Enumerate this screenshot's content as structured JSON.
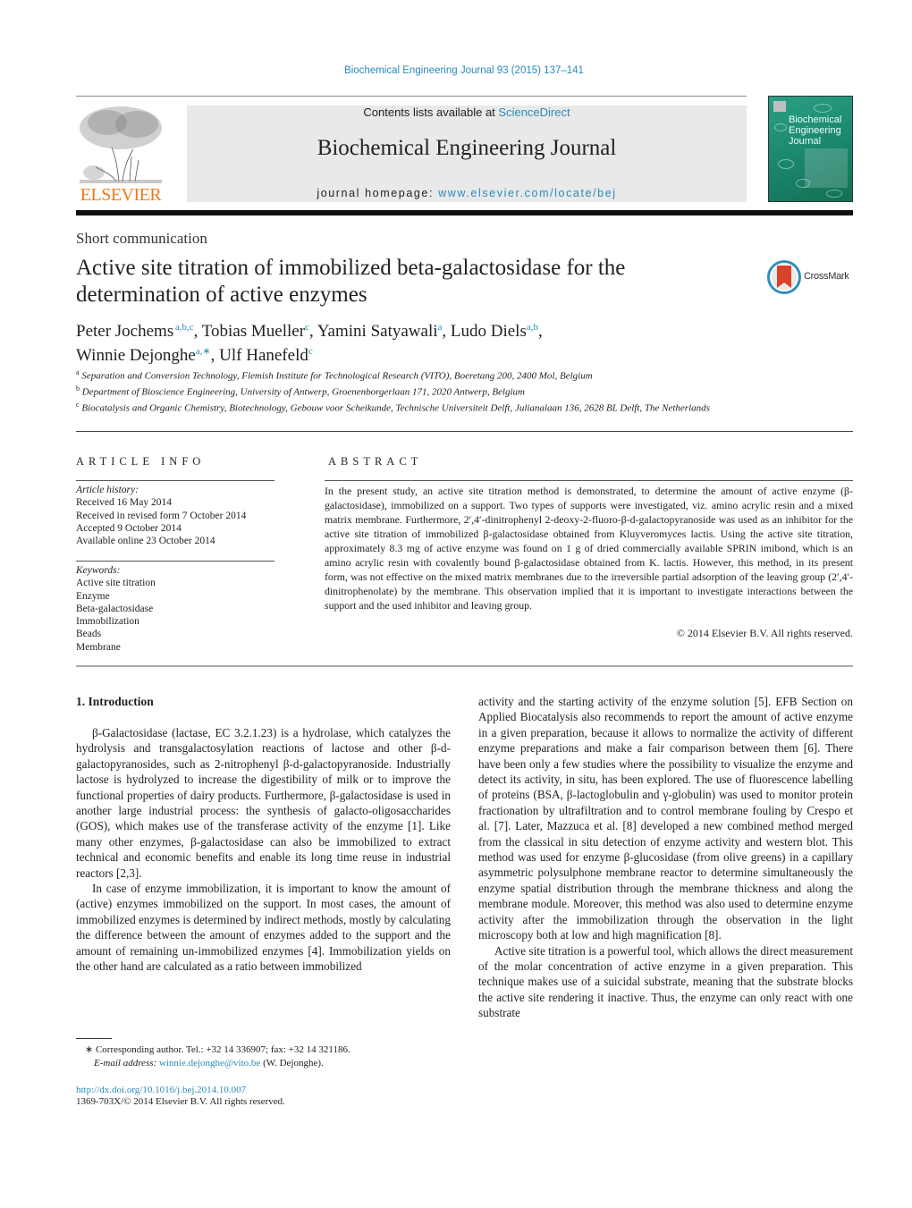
{
  "header": {
    "journal_ref": "Biochemical Engineering Journal 93 (2015) 137–141",
    "contents_prefix": "Contents lists available at ",
    "contents_link": "ScienceDirect",
    "journal_title": "Biochemical Engineering Journal",
    "homepage_prefix": "journal homepage: ",
    "homepage_link": "www.elsevier.com/locate/bej",
    "publisher_logo_text": "ELSEVIER",
    "cover_title_lines": [
      "Biochemical",
      "Engineering",
      "Journal"
    ],
    "crossmark_label": "CrossMark",
    "colors": {
      "link": "#2a8bb8",
      "elsevier_orange": "#f07a1a",
      "cover_green": "#1d8a70",
      "crossmark_red": "#d9412b"
    }
  },
  "article": {
    "type": "Short communication",
    "title": "Active site titration of immobilized beta-galactosidase for the determination of active enzymes",
    "authors": [
      {
        "name": "Peter Jochems",
        "affil": "a,b,c",
        "sep": ", "
      },
      {
        "name": "Tobias Mueller",
        "affil": "c",
        "sep": ", "
      },
      {
        "name": "Yamini Satyawali",
        "affil": "a",
        "sep": ", "
      },
      {
        "name": "Ludo Diels",
        "affil": "a,b",
        "sep": ", "
      },
      {
        "name": "Winnie Dejonghe",
        "affil": "a,∗",
        "sep": ", "
      },
      {
        "name": "Ulf Hanefeld",
        "affil": "c",
        "sep": ""
      }
    ],
    "affiliations": [
      {
        "key": "a",
        "text": "Separation and Conversion Technology, Flemish Institute for Technological Research (VITO), Boeretang 200, 2400 Mol, Belgium"
      },
      {
        "key": "b",
        "text": "Department of Bioscience Engineering, University of Antwerp, Groenenborgerlaan 171, 2020 Antwerp, Belgium"
      },
      {
        "key": "c",
        "text": "Biocatalysis and Organic Chemistry, Biotechnology, Gebouw voor Scheikunde, Technische Universiteit Delft, Julianalaan 136, 2628 BL Delft, The Netherlands"
      }
    ]
  },
  "article_info": {
    "label": "ARTICLE INFO",
    "history_head": "Article history:",
    "history": [
      "Received 16 May 2014",
      "Received in revised form 7 October 2014",
      "Accepted 9 October 2014",
      "Available online 23 October 2014"
    ],
    "keywords_head": "Keywords:",
    "keywords": [
      "Active site titration",
      "Enzyme",
      "Beta-galactosidase",
      "Immobilization",
      "Beads",
      "Membrane"
    ]
  },
  "abstract": {
    "label": "ABSTRACT",
    "text": "In the present study, an active site titration method is demonstrated, to determine the amount of active enzyme (β-galactosidase), immobilized on a support. Two types of supports were investigated, viz. amino acrylic resin and a mixed matrix membrane. Furthermore, 2′,4′-dinitrophenyl 2-deoxy-2-fluoro-β-d-galactopyranoside was used as an inhibitor for the active site titration of immobilized β-galactosidase obtained from Kluyveromyces lactis. Using the active site titration, approximately 8.3 mg of active enzyme was found on 1 g of dried commercially available SPRIN imibond, which is an amino acrylic resin with covalently bound β-galactosidase obtained from K. lactis. However, this method, in its present form, was not effective on the mixed matrix membranes due to the irreversible partial adsorption of the leaving group (2′,4′-dinitrophenolate) by the membrane. This observation implied that it is important to investigate interactions between the support and the used inhibitor and leaving group.",
    "copyright": "© 2014 Elsevier B.V. All rights reserved."
  },
  "body": {
    "section_heading": "1.  Introduction",
    "left_paragraphs": [
      "β-Galactosidase (lactase, EC 3.2.1.23) is a hydrolase, which catalyzes the hydrolysis and transgalactosylation reactions of lactose and other β-d-galactopyranosides, such as 2-nitrophenyl β-d-galactopyranoside. Industrially lactose is hydrolyzed to increase the digestibility of milk or to improve the functional properties of dairy products. Furthermore, β-galactosidase is used in another large industrial process: the synthesis of galacto-oligosaccharides (GOS), which makes use of the transferase activity of the enzyme [1]. Like many other enzymes, β-galactosidase can also be immobilized to extract technical and economic benefits and enable its long time reuse in industrial reactors [2,3].",
      "In case of enzyme immobilization, it is important to know the amount of (active) enzymes immobilized on the support. In most cases, the amount of immobilized enzymes is determined by indirect methods, mostly by calculating the difference between the amount of enzymes added to the support and the amount of remaining un-immobilized enzymes [4]. Immobilization yields on the other hand are calculated as a ratio between immobilized"
    ],
    "right_paragraphs": [
      "activity and the starting activity of the enzyme solution [5]. EFB Section on Applied Biocatalysis also recommends to report the amount of active enzyme in a given preparation, because it allows to normalize the activity of different enzyme preparations and make a fair comparison between them [6]. There have been only a few studies where the possibility to visualize the enzyme and detect its activity, in situ, has been explored. The use of fluorescence labelling of proteins (BSA, β-lactoglobulin and γ-globulin) was used to monitor protein fractionation by ultrafiltration and to control membrane fouling by Crespo et al. [7]. Later, Mazzuca et al. [8] developed a new combined method merged from the classical in situ detection of enzyme activity and western blot. This method was used for enzyme β-glucosidase (from olive greens) in a capillary asymmetric polysulphone membrane reactor to determine simultaneously the enzyme spatial distribution through the membrane thickness and along the membrane module. Moreover, this method was also used to determine enzyme activity after the immobilization through the observation in the light microscopy both at low and high magnification [8].",
      "Active site titration is a powerful tool, which allows the direct measurement of the molar concentration of active enzyme in a given preparation. This technique makes use of a suicidal substrate, meaning that the substrate blocks the active site rendering it inactive. Thus, the enzyme can only react with one substrate"
    ]
  },
  "footer": {
    "corresponding_line": "∗  Corresponding author. Tel.: +32 14 336907; fax: +32 14 321186.",
    "email_label": "E-mail address: ",
    "email": "winnie.dejonghe@vito.be",
    "email_suffix": " (W. Dejonghe).",
    "doi": "http://dx.doi.org/10.1016/j.bej.2014.10.007",
    "issn_line": "1369-703X/© 2014 Elsevier B.V. All rights reserved."
  }
}
